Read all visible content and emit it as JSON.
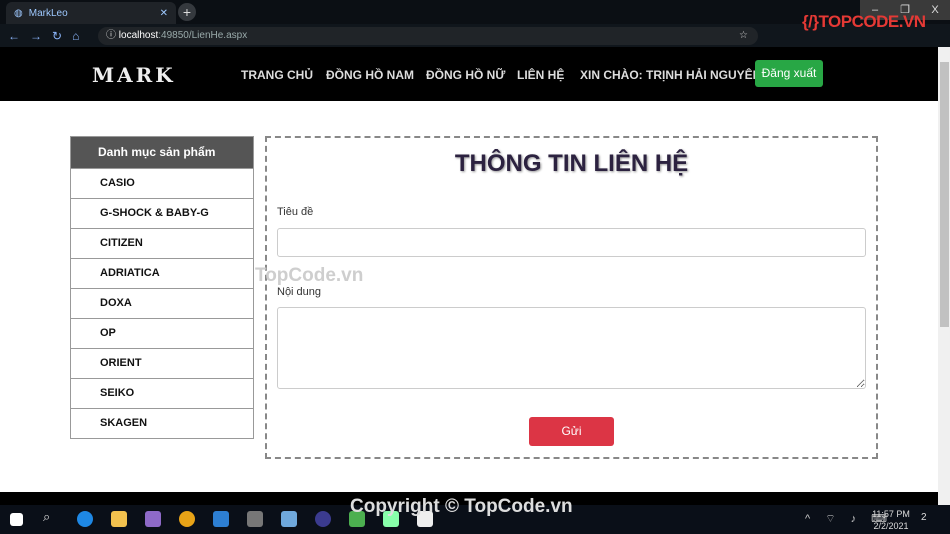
{
  "browser": {
    "tab_title": "MarkLeo",
    "url_host": "localhost",
    "url_rest": ":49850/LienHe.aspx",
    "new_tab": "+",
    "win_min": "–",
    "win_max": "❐",
    "win_close": "X"
  },
  "watermark": {
    "brand_top": "TOPCODE",
    "brand_domain": ".VN",
    "mid": "TopCode.vn",
    "bottom": "Copyright © TopCode.vn"
  },
  "nav": {
    "logo": "MARK",
    "links": [
      "TRANG CHỦ",
      "ĐỒNG HỒ NAM",
      "ĐỒNG HỒ NỮ",
      "LIÊN HỆ",
      "XIN CHÀO: TRỊNH HẢI NGUYÊN"
    ],
    "logout": "Đăng xuất"
  },
  "sidebar": {
    "header": "Danh mục sản phẩm",
    "items": [
      "CASIO",
      "G-SHOCK & BABY-G",
      "CITIZEN",
      "ADRIATICA",
      "DOXA",
      "OP",
      "ORIENT",
      "SEIKO",
      "SKAGEN"
    ]
  },
  "form": {
    "title": "THÔNG TIN LIÊN HỆ",
    "subject_label": "Tiêu đề",
    "subject_value": "",
    "content_label": "Nội dung",
    "content_value": "",
    "submit": "Gửi"
  },
  "taskbar": {
    "time": "11:57 PM",
    "date": "2/2/2021",
    "notifications": "2"
  },
  "colors": {
    "nav_bg": "#000000",
    "logout": "#28a745",
    "submit": "#dc3545",
    "sidebar_header": "#555555"
  }
}
